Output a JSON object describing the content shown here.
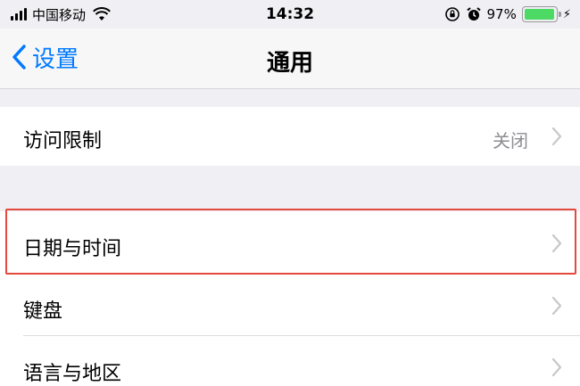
{
  "status_bar": {
    "carrier": "中国移动",
    "time": "14:32",
    "battery_percent": "97%",
    "battery_level": 0.97,
    "icons": [
      "signal-icon",
      "wifi-icon",
      "lock-rotation-icon",
      "alarm-icon",
      "battery-icon",
      "charging-icon"
    ]
  },
  "nav": {
    "back_label": "设置",
    "title": "通用"
  },
  "sections": [
    {
      "rows": [
        {
          "label": "访问限制",
          "detail": "关闭"
        }
      ]
    },
    {
      "rows": [
        {
          "label": "日期与时间",
          "detail": ""
        },
        {
          "label": "键盘",
          "detail": ""
        },
        {
          "label": "语言与地区",
          "detail": ""
        }
      ]
    }
  ],
  "colors": {
    "ios_blue": "#007aff",
    "highlight": "#e5483c",
    "battery_green": "#4cd964",
    "background": "#efeff4"
  }
}
